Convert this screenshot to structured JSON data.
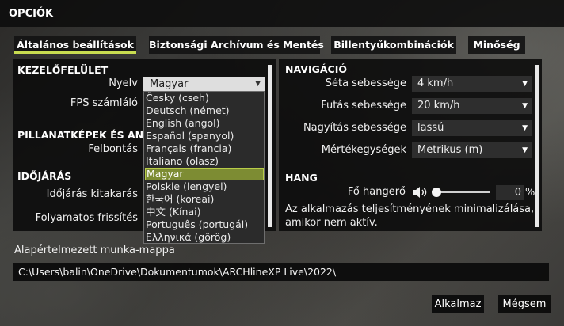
{
  "window": {
    "title": "OPCIÓK"
  },
  "tabs": [
    {
      "label": "Általános beállítások",
      "active": true
    },
    {
      "label": "Biztonsági Archívum és Mentés",
      "active": false
    },
    {
      "label": "Billentyűkombinációk",
      "active": false
    },
    {
      "label": "Minőség",
      "active": false
    }
  ],
  "accent_color": "#c8dc50",
  "left_panel": {
    "kezelofelulet": {
      "title": "KEZELŐFELÜLET",
      "language_label": "Nyelv",
      "language_value": "Magyar",
      "fps_label": "FPS számláló"
    },
    "pillanatkepek": {
      "title": "PILLANATKÉPEK ÉS ANIM",
      "resolution_label": "Felbontás"
    },
    "idojaras": {
      "title": "IDŐJÁRÁS",
      "weather_label": "Időjárás kitakarás",
      "refresh_label": "Folyamatos frissítés"
    }
  },
  "language_dropdown": {
    "options": [
      "Česky (cseh)",
      "Deutsch (német)",
      "English (angol)",
      "Español (spanyol)",
      "Français (francia)",
      "Italiano (olasz)",
      "Magyar",
      "Polskie (lengyel)",
      "한국어 (koreai)",
      "中文 (Kínai)",
      "Português (portugál)",
      "Ελληνικά (görög)"
    ],
    "selected_index": 6
  },
  "right_panel": {
    "navigacio": {
      "title": "NAVIGÁCIÓ",
      "walk_label": "Séta sebessége",
      "walk_value": "4 km/h",
      "run_label": "Futás sebessége",
      "run_value": "20 km/h",
      "zoom_label": "Nagyítás sebessége",
      "zoom_value": "lassú",
      "units_label": "Mértékegységek",
      "units_value": "Metrikus (m)"
    },
    "hang": {
      "title": "HANG",
      "volume_label": "Fő hangerő",
      "volume_level": 0,
      "volume_value": "0",
      "volume_unit": "%",
      "minimize_text_line1": "Az alkalmazás teljesítményének minimalizálása,",
      "minimize_text_line2": "amikor nem aktív."
    }
  },
  "work_folder": {
    "label": "Alapértelmezett munka-mappa",
    "path": "C:\\Users\\balin\\OneDrive\\Dokumentumok\\ARCHlineXP Live\\2022\\"
  },
  "buttons": {
    "apply": "Alkalmaz",
    "cancel": "Mégsem"
  }
}
